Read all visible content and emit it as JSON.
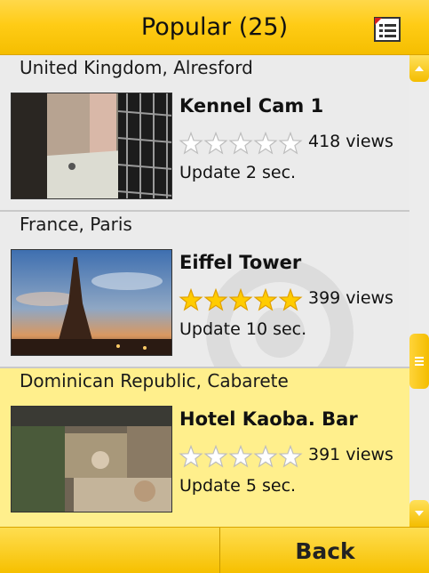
{
  "header": {
    "title": "Popular (25)",
    "menu_icon": "list-menu-icon"
  },
  "cameras": [
    {
      "location": "United Kingdom, Alresford",
      "name": "Kennel Cam 1",
      "rating": 0,
      "views": "418 views",
      "update": "Update 2 sec.",
      "selected": false
    },
    {
      "location": "France, Paris",
      "name": "Eiffel Tower",
      "rating": 5,
      "views": "399 views",
      "update": "Update 10 sec.",
      "selected": false
    },
    {
      "location": "Dominican Republic, Cabarete",
      "name": "Hotel Kaoba. Bar",
      "rating": 0,
      "views": "391 views",
      "update": "Update 5 sec.",
      "selected": true
    }
  ],
  "rating_max": 5,
  "colors": {
    "accent": "#ffcc16",
    "selected_row": "#ffef8c",
    "list_bg": "#ebebeb",
    "star_filled": "#ffcc00",
    "star_empty": "#ffffff"
  },
  "softkeys": {
    "left": "",
    "right": "Back"
  }
}
